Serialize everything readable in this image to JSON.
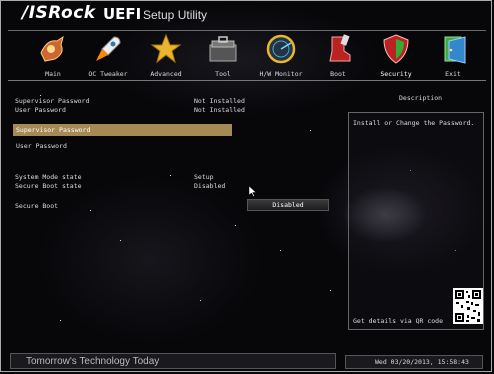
{
  "header": {
    "brand": "/ISRock",
    "product": "UEFI",
    "subtitle": "Setup Utility"
  },
  "nav": {
    "items": [
      {
        "label": "Main",
        "icon": "main-icon"
      },
      {
        "label": "OC Tweaker",
        "icon": "rocket-icon"
      },
      {
        "label": "Advanced",
        "icon": "star-icon"
      },
      {
        "label": "Tool",
        "icon": "toolbox-icon"
      },
      {
        "label": "H/W Monitor",
        "icon": "radar-icon"
      },
      {
        "label": "Boot",
        "icon": "boot-icon"
      },
      {
        "label": "Security",
        "icon": "shield-icon"
      },
      {
        "label": "Exit",
        "icon": "exit-door-icon"
      }
    ],
    "active": "Security"
  },
  "status": {
    "supervisor_label": "Supervisor Password",
    "supervisor_value": "Not Installed",
    "user_label": "User Password",
    "user_value": "Not Installed"
  },
  "options": {
    "supervisor_password": "Supervisor Password",
    "user_password": "User Password"
  },
  "secure_boot_info": {
    "system_mode_label": "System Mode state",
    "system_mode_value": "Setup",
    "secure_boot_state_label": "Secure Boot state",
    "secure_boot_state_value": "Disabled",
    "secure_boot_label": "Secure Boot",
    "secure_boot_value": "Disabled"
  },
  "description": {
    "title": "Description",
    "text": "Install or Change the Password.",
    "qr_note": "Get details via QR code"
  },
  "footer": {
    "tagline": "Tomorrow's Technology Today",
    "datetime": "Wed 03/20/2013, 15:58:43"
  },
  "colors": {
    "highlight": "#a58a55",
    "background": "#07070a"
  }
}
